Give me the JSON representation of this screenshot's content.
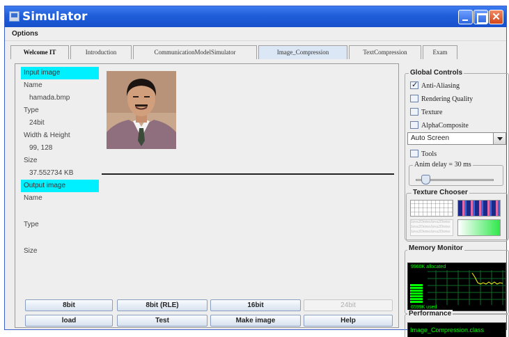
{
  "window": {
    "title": "Simulator"
  },
  "menu": {
    "options": "Options"
  },
  "tabs": [
    {
      "label": "Welcome IT",
      "active": false
    },
    {
      "label": "Introduction",
      "active": false
    },
    {
      "label": "CommunicationModelSimulator",
      "active": false
    },
    {
      "label": "Image_Compression",
      "active": true
    },
    {
      "label": "TextCompression",
      "active": false
    },
    {
      "label": "Exam",
      "active": false
    }
  ],
  "image_info": {
    "input_header": "Input image",
    "name_label": "Name",
    "name_value": "hamada.bmp",
    "type_label": "Type",
    "type_value": "24bit",
    "wh_label": "Width & Height",
    "wh_value": "99, 128",
    "size_label": "Size",
    "size_value": "37.552734  KB",
    "output_header": "Output image",
    "out_name_label": "Name",
    "out_type_label": "Type",
    "out_size_label": "Size"
  },
  "buttons": {
    "b8bit": "8bit",
    "b8bit_rle": "8bit (RLE)",
    "b16bit": "16bit",
    "b24bit": "24bit",
    "load": "load",
    "test": "Test",
    "make_image": "Make image",
    "help": "Help"
  },
  "global_controls": {
    "title": "Global Controls",
    "anti_aliasing": "Anti-Aliasing",
    "anti_aliasing_checked": true,
    "rendering_quality": "Rendering Quality",
    "texture": "Texture",
    "alpha_composite": "AlphaComposite",
    "screen_select": "Auto Screen",
    "tools": "Tools",
    "anim_delay": "Anim delay = 30 ms",
    "anim_delay_ms": 30
  },
  "texture_chooser": {
    "title": "Texture Chooser",
    "text_tile": "Java2Demo"
  },
  "memory_monitor": {
    "title": "Memory Monitor",
    "allocated": "9960K allocated",
    "used": "6599K used"
  },
  "performance": {
    "title": "Performance",
    "text": "Image_Compression.class"
  },
  "colors": {
    "title_bar": "#1f5ed8",
    "highlight": "#00f0ff",
    "monitor_green": "#00ff00"
  }
}
